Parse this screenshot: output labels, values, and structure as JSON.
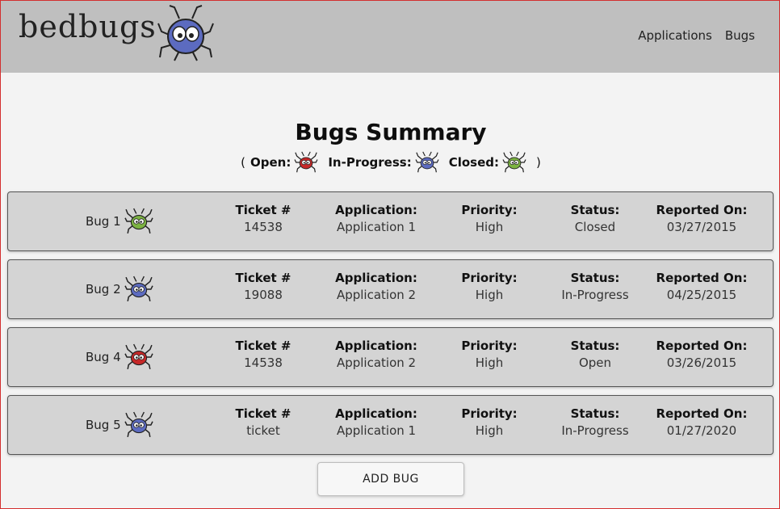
{
  "header": {
    "logo_text": "bedbugs",
    "nav": [
      "Applications",
      "Bugs"
    ]
  },
  "main": {
    "title": "Bugs Summary",
    "legend": {
      "open_paren": "(",
      "open_label": "Open:",
      "inprogress_label": "In-Progress:",
      "closed_label": "Closed:",
      "close_paren": ")"
    },
    "columns": {
      "ticket": "Ticket #",
      "application": "Application:",
      "priority": "Priority:",
      "status": "Status:",
      "reported": "Reported On:"
    },
    "bugs": [
      {
        "name": "Bug 1",
        "ticket": "14538",
        "application": "Application 1",
        "priority": "High",
        "status": "Closed",
        "reported": "03/27/2015",
        "icon": "closed-bug-icon"
      },
      {
        "name": "Bug 2",
        "ticket": "19088",
        "application": "Application 2",
        "priority": "High",
        "status": "In-Progress",
        "reported": "04/25/2015",
        "icon": "inprogress-bug-icon"
      },
      {
        "name": "Bug 4",
        "ticket": "14538",
        "application": "Application 2",
        "priority": "High",
        "status": "Open",
        "reported": "03/26/2015",
        "icon": "open-bug-icon"
      },
      {
        "name": "Bug 5",
        "ticket": "ticket",
        "application": "Application 1",
        "priority": "High",
        "status": "In-Progress",
        "reported": "01/27/2020",
        "icon": "inprogress-bug-icon"
      }
    ],
    "add_button": "ADD BUG"
  },
  "colors": {
    "open": "#c62828",
    "in_progress": "#5c6bc0",
    "closed": "#7cb342"
  }
}
